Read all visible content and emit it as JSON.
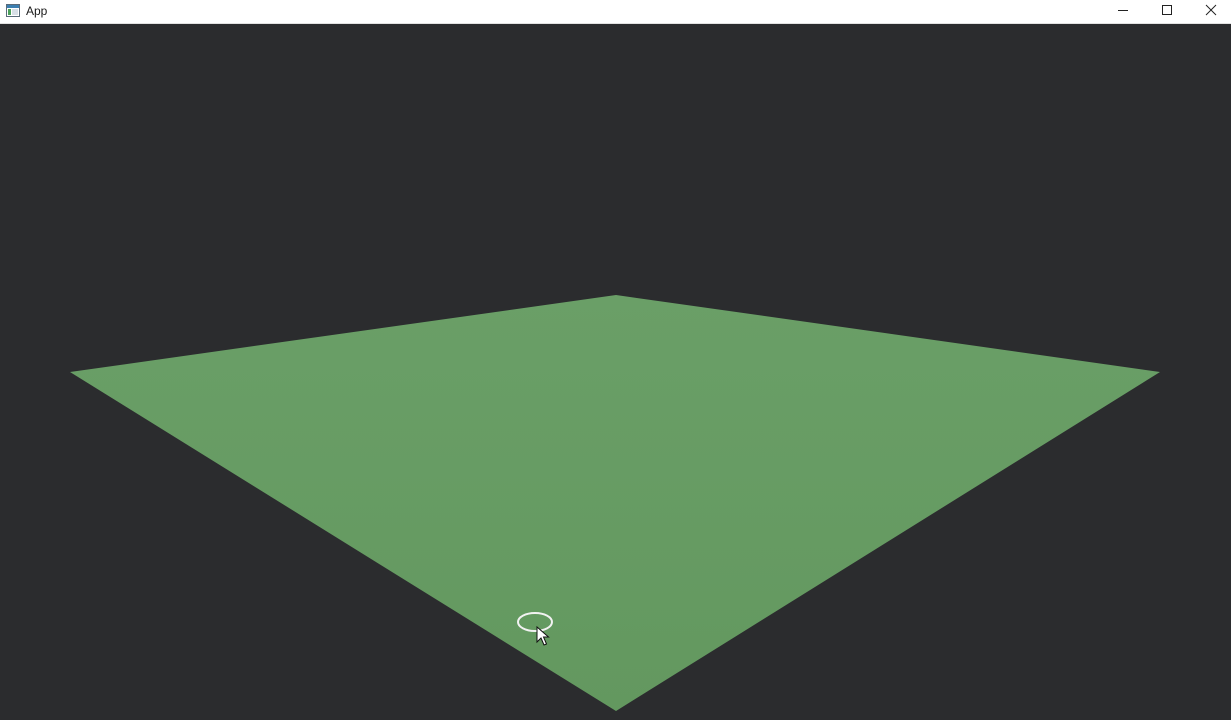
{
  "window": {
    "title": "App",
    "icon": "app-window-icon",
    "controls": {
      "minimize_icon": "minimize-icon",
      "maximize_icon": "maximize-icon",
      "close_icon": "close-icon"
    }
  },
  "viewport": {
    "background_color": "#2b2c2e",
    "plane_color": "#669a63",
    "plane_edge_color": "#6c9f68",
    "cursor": {
      "icon": "mouse-pointer-icon",
      "ring_color": "#f2f2f2"
    }
  }
}
